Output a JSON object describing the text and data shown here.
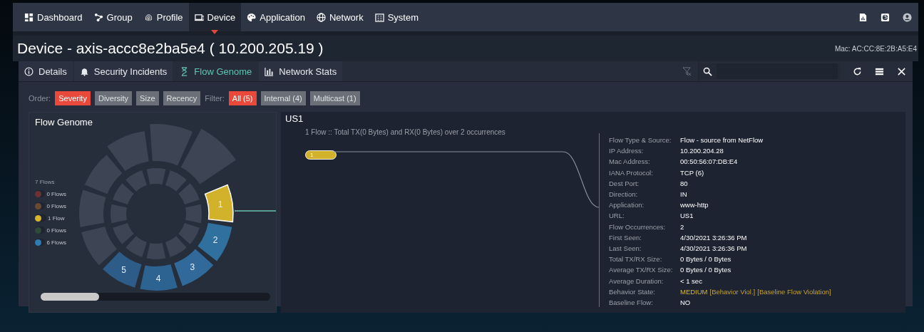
{
  "nav": {
    "items": [
      {
        "label": "Dashboard",
        "selected": false
      },
      {
        "label": "Group",
        "selected": false
      },
      {
        "label": "Profile",
        "selected": false
      },
      {
        "label": "Device",
        "selected": true
      },
      {
        "label": "Application",
        "selected": false
      },
      {
        "label": "Network",
        "selected": false
      },
      {
        "label": "System",
        "selected": false
      }
    ]
  },
  "page": {
    "title": "Device - axis-accc8e2ba5e4 ( 10.200.205.19 )",
    "mac": "Mac: AC:CC:8E:2B:A5:E4"
  },
  "tabs": [
    {
      "label": "Details",
      "selected": false
    },
    {
      "label": "Security Incidents",
      "selected": false
    },
    {
      "label": "Flow Genome",
      "selected": true
    },
    {
      "label": "Network Stats",
      "selected": false
    }
  ],
  "order": {
    "label": "Order:",
    "options": [
      {
        "label": "Severity",
        "selected": true
      },
      {
        "label": "Diversity",
        "selected": false
      },
      {
        "label": "Size",
        "selected": false
      },
      {
        "label": "Recency",
        "selected": false
      }
    ]
  },
  "filter": {
    "label": "Filter:",
    "options": [
      {
        "label": "All (5)",
        "selected": true
      },
      {
        "label": "Internal (4)",
        "selected": false
      },
      {
        "label": "Multicast (1)",
        "selected": false
      }
    ]
  },
  "genome": {
    "title": "Flow Genome",
    "total": "7 Flows",
    "legend": [
      {
        "label": "0 Flows",
        "color": "#6e2f36"
      },
      {
        "label": "0 Flows",
        "color": "#6a4a33"
      },
      {
        "label": "1 Flow",
        "color": "#d4b52b"
      },
      {
        "label": "0 Flows",
        "color": "#2f4a3a"
      },
      {
        "label": "6 Flows",
        "color": "#2e7bb6"
      }
    ],
    "segments": [
      {
        "label": "1",
        "color": "#d1b22a",
        "selected": true
      },
      {
        "label": "2",
        "color": "#30709f",
        "selected": false
      },
      {
        "label": "3",
        "color": "#30699a",
        "selected": false
      },
      {
        "label": "4",
        "color": "#2d6391",
        "selected": false
      },
      {
        "label": "5",
        "color": "#2c5c87",
        "selected": false
      }
    ]
  },
  "flow": {
    "title": "US1",
    "summary": "1 Flow :: Total TX(0 Bytes) and RX(0 Bytes) over 2 occurrences",
    "node": "1",
    "details": [
      {
        "label": "Flow Type & Source:",
        "kind": "text",
        "value": "Flow - source from NetFlow"
      },
      {
        "label": "IP Address:",
        "kind": "text",
        "value": "10.200.204.28"
      },
      {
        "label": "Mac Address:",
        "kind": "text",
        "value": "00:50:56:07:DB:E4"
      },
      {
        "label": "IANA Protocol:",
        "kind": "text",
        "value": "TCP (6)"
      },
      {
        "label": "Dest Port:",
        "kind": "text",
        "value": "80"
      },
      {
        "label": "Direction:",
        "kind": "text",
        "value": "IN"
      },
      {
        "label": "Application:",
        "kind": "text",
        "value": "www-http"
      },
      {
        "label": "URL:",
        "kind": "text",
        "value": "US1"
      },
      {
        "label": "Flow Occurrences:",
        "kind": "text",
        "value": "2"
      },
      {
        "label": "First Seen:",
        "kind": "text",
        "value": "4/30/2021 3:26:36 PM"
      },
      {
        "label": "Last Seen:",
        "kind": "text",
        "value": "4/30/2021 3:26:36 PM"
      },
      {
        "label": "Total TX/RX Size:",
        "kind": "text",
        "value": "0 Bytes / 0 Bytes"
      },
      {
        "label": "Average TX/RX Size:",
        "kind": "text",
        "value": "0 Bytes / 0 Bytes"
      },
      {
        "label": "Average Duration:",
        "kind": "text",
        "value": "< 1 sec"
      },
      {
        "label": "Behavior State:",
        "kind": "tags",
        "tags": [
          "MEDIUM",
          "[Behavior Viol.]",
          "[Baseline Flow Violation]"
        ]
      },
      {
        "label": "Baseline Flow:",
        "kind": "text",
        "value": "NO"
      }
    ]
  }
}
